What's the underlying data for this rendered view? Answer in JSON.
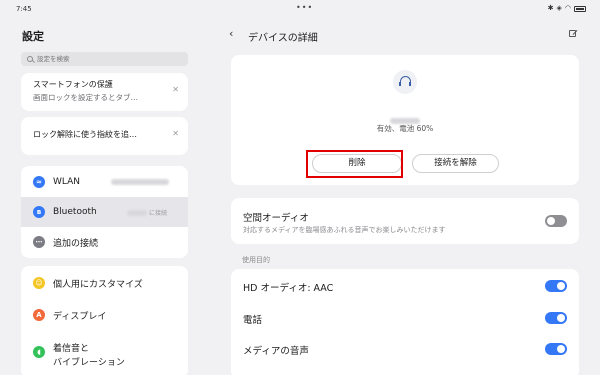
{
  "status_bar": {
    "time": "7:45",
    "dots": "•••",
    "battery_icon": "battery-icon",
    "wifi_icon": "wifi-icon"
  },
  "left_pane": {
    "title": "設定",
    "search_placeholder": "設定を検索",
    "tips": [
      {
        "line1": "スマートフォンの保護",
        "line2": "画面ロックを設定するとタブ…"
      },
      {
        "line1": "ロック解除に使う指紋を追…"
      }
    ],
    "connections": [
      {
        "label": "WLAN",
        "icon": "wifi-icon",
        "color": "#3478f6"
      },
      {
        "label": "Bluetooth",
        "value": "に接続",
        "icon": "bluetooth-icon",
        "color": "#3478f6"
      },
      {
        "label": "追加の接続",
        "icon": "more-connections-icon",
        "color": "#7c7c84"
      }
    ],
    "personal": [
      {
        "label": "個人用にカスタマイズ",
        "icon": "personalize-icon",
        "color": "#f5c623"
      },
      {
        "label": "ディスプレイ",
        "icon": "display-icon",
        "color": "#f2693a"
      },
      {
        "label": "着信音と",
        "label2": "バイブレーション",
        "icon": "sound-icon",
        "color": "#33c15a"
      }
    ]
  },
  "right_pane": {
    "title": "デバイスの詳細",
    "device": {
      "status": "有効、電池 60%",
      "delete_label": "削除",
      "disconnect_label": "接続を解除"
    },
    "spatial_audio": {
      "title": "空間オーディオ",
      "description": "対応するメディアを臨場感あふれる音声でお楽しみいただけます",
      "enabled": false
    },
    "usage_section_label": "使用目的",
    "usage": [
      {
        "label": "HD オーディオ: AAC",
        "enabled": true
      },
      {
        "label": "電話",
        "enabled": true
      },
      {
        "label": "メディアの音声",
        "enabled": true
      }
    ]
  }
}
